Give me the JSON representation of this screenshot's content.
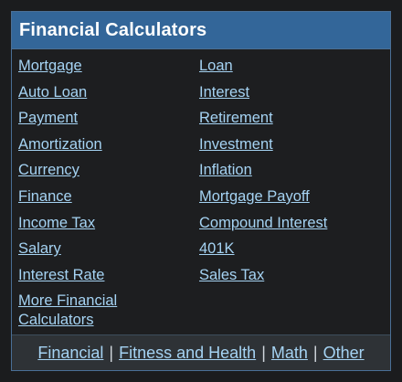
{
  "header": {
    "title": "Financial Calculators"
  },
  "links": {
    "left": [
      "Mortgage",
      "Auto Loan",
      "Payment",
      "Amortization",
      "Currency",
      "Finance",
      "Income Tax",
      "Salary",
      "Interest Rate",
      "More Financial Calculators"
    ],
    "right": [
      "Loan",
      "Interest",
      "Retirement",
      "Investment",
      "Inflation",
      "Mortgage Payoff",
      "Compound Interest",
      "401K",
      "Sales Tax"
    ]
  },
  "footer": {
    "items": [
      "Financial",
      "Fitness and Health",
      "Math",
      "Other"
    ],
    "separator": "|"
  },
  "colors": {
    "header_bg": "#336699",
    "link": "#a5d3f3",
    "panel_bg": "#1d1e20",
    "footer_bg": "#2e3236"
  }
}
